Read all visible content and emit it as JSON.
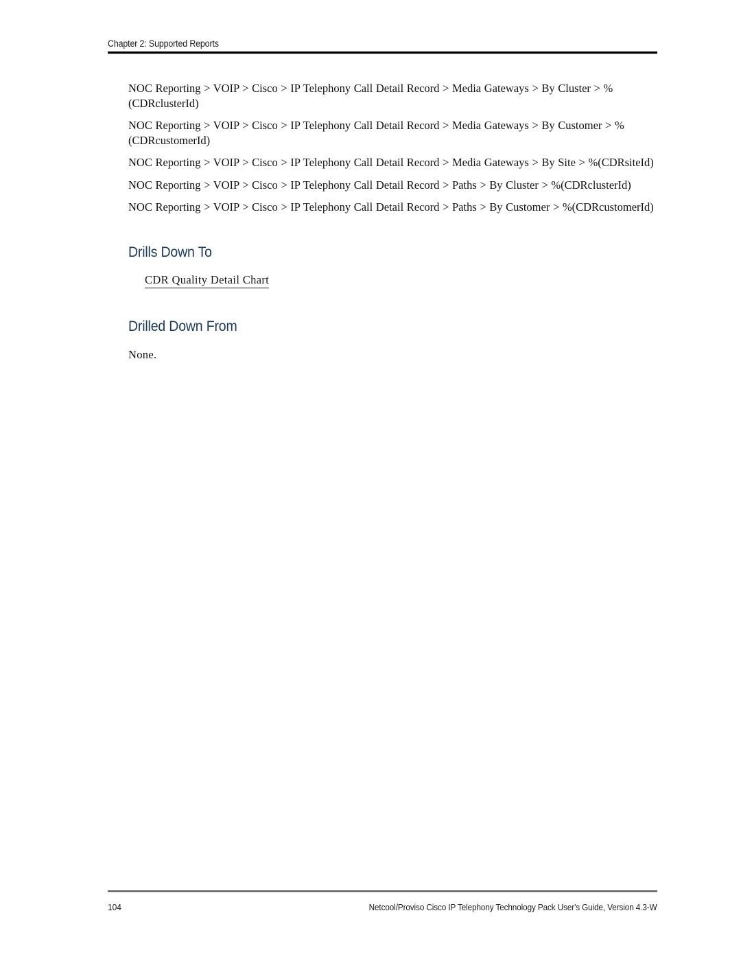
{
  "header": {
    "chapter_label": "Chapter 2: Supported Reports"
  },
  "content": {
    "report_paths": [
      "NOC Reporting > VOIP > Cisco > IP Telephony Call Detail Record > Media Gateways > By Cluster > %(CDRclusterId)",
      "NOC Reporting > VOIP > Cisco > IP Telephony Call Detail Record > Media Gateways > By Customer > %(CDRcustomerId)",
      "NOC Reporting > VOIP > Cisco > IP Telephony Call Detail Record > Media Gateways > By Site > %(CDRsiteId)",
      "NOC Reporting > VOIP > Cisco > IP Telephony Call Detail Record > Paths > By Cluster > %(CDRclusterId)",
      "NOC Reporting > VOIP > Cisco > IP Telephony Call Detail Record > Paths > By Customer > %(CDRcustomerId)"
    ],
    "drills_down_to": {
      "heading": "Drills Down To",
      "link_label": "CDR Quality Detail Chart"
    },
    "drilled_down_from": {
      "heading": "Drilled Down From",
      "body": "None."
    }
  },
  "footer": {
    "page_number": "104",
    "guide_title": "Netcool/Proviso Cisco IP Telephony Technology Pack User's Guide, Version 4.3-W"
  },
  "colors": {
    "heading_navy": "#1b3a5c",
    "body_text": "#111111",
    "header_rule": "#000000",
    "footer_rule": "#5a5a5a",
    "page_background": "#ffffff"
  }
}
